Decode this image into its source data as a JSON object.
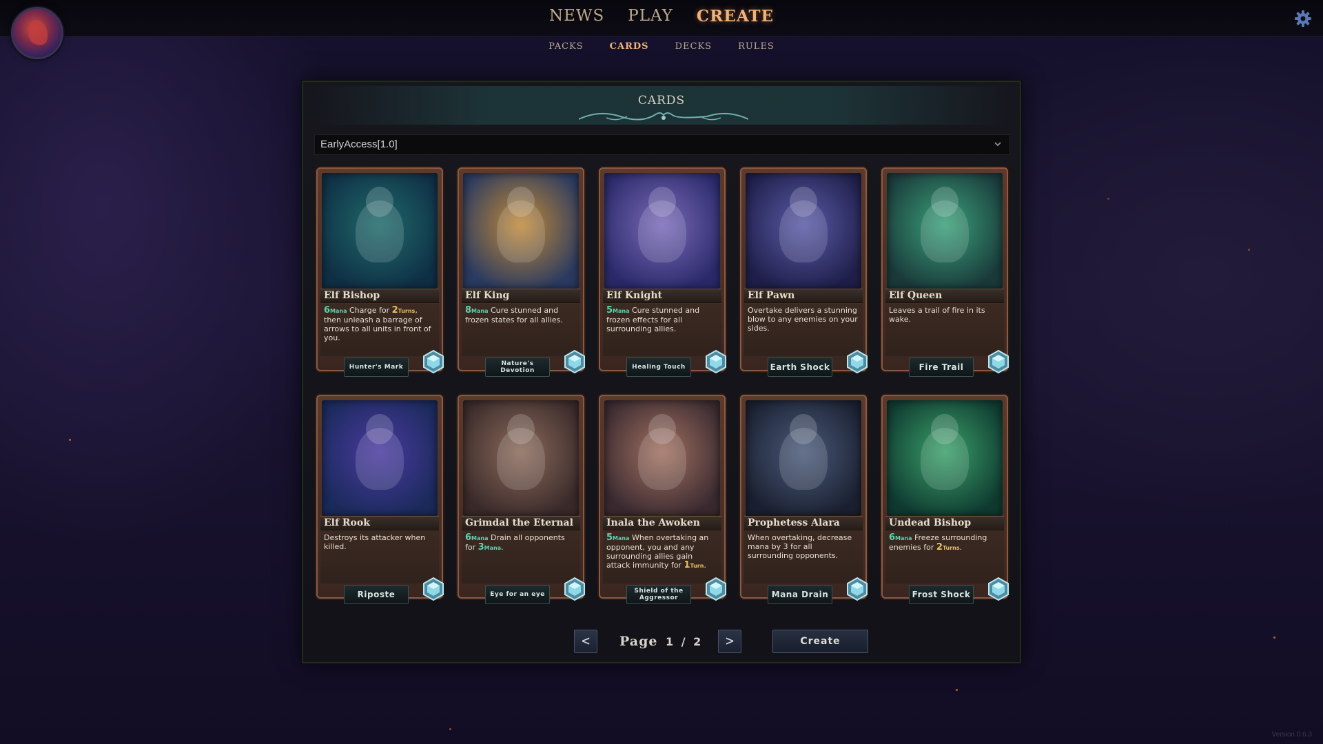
{
  "nav": {
    "main": [
      {
        "label": "NEWS",
        "active": false
      },
      {
        "label": "PLAY",
        "active": false
      },
      {
        "label": "CREATE",
        "active": true
      }
    ],
    "sub": [
      {
        "label": "PACKS",
        "active": false
      },
      {
        "label": "CARDS",
        "active": true
      },
      {
        "label": "DECKS",
        "active": false
      },
      {
        "label": "RULES",
        "active": false
      }
    ]
  },
  "icons": {
    "avatar": "dragon-avatar-icon",
    "settings": "gear-icon",
    "dropdown": "chevron-down-icon",
    "gem": "crystal-gem-icon"
  },
  "panel": {
    "title": "CARDS"
  },
  "set_selector": {
    "value": "EarlyAccess[1.0]"
  },
  "cards": [
    {
      "name": "Elf Bishop",
      "mana": "6",
      "mana_label": "Mana",
      "text_parts": [
        "Charge for ",
        "2",
        "Turns",
        ", then unleash a barrage of arrows to all units in front of you."
      ],
      "ability": "Hunter's Mark",
      "ability_size": "small",
      "art_colors": [
        "#1f6a6a",
        "#0f2f45"
      ]
    },
    {
      "name": "Elf King",
      "mana": "8",
      "mana_label": "Mana",
      "text": "Cure stunned and frozen states for all allies.",
      "ability": "Nature's Devotion",
      "ability_size": "small",
      "art_colors": [
        "#c08a3a",
        "#2a3a60"
      ]
    },
    {
      "name": "Elf Knight",
      "mana": "5",
      "mana_label": "Mana",
      "text": "Cure stunned and frozen effects for all surrounding allies.",
      "ability": "Healing Touch",
      "ability_size": "small",
      "art_colors": [
        "#7a6ab8",
        "#2a2a6a"
      ]
    },
    {
      "name": "Elf Pawn",
      "text": "Overtake delivers a stunning blow to any enemies on your sides.",
      "ability": "Earth Shock",
      "ability_size": "big",
      "art_colors": [
        "#5a5aa8",
        "#1f1f4a"
      ]
    },
    {
      "name": "Elf Queen",
      "text": "Leaves a trail of fire in its wake.",
      "ability": "Fire Trail",
      "ability_size": "big",
      "art_colors": [
        "#3aa07a",
        "#1a3a3a"
      ]
    },
    {
      "name": "Elf Rook",
      "text": "Destroys its attacker when killed.",
      "ability": "Riposte",
      "ability_size": "big",
      "art_colors": [
        "#4a3aa0",
        "#1a2a5a"
      ]
    },
    {
      "name": "Grimdal the Eternal",
      "mana": "6",
      "mana_label": "Mana",
      "text_parts": [
        "Drain all opponents for ",
        "3",
        "Mana",
        "."
      ],
      "ability": "Eye for an eye",
      "ability_size": "small",
      "art_colors": [
        "#8a6a5a",
        "#3a2a2a"
      ]
    },
    {
      "name": "Inala the Awoken",
      "mana": "5",
      "mana_label": "Mana",
      "text_parts": [
        "When overtaking an opponent, you and any surrounding allies gain attack immunity for ",
        "1",
        "Turn",
        "."
      ],
      "ability": "Shield of the Aggressor",
      "ability_size": "small",
      "art_colors": [
        "#a07060",
        "#3a2a30"
      ]
    },
    {
      "name": "Prophetess Alara",
      "text": "When overtaking, decrease mana by 3 for all surrounding opponents.",
      "ability": "Mana Drain",
      "ability_size": "big",
      "art_colors": [
        "#4a5a7a",
        "#1a2030"
      ]
    },
    {
      "name": "Undead Bishop",
      "mana": "6",
      "mana_label": "Mana",
      "text_parts": [
        "Freeze surrounding enemies for ",
        "2",
        "Turns",
        "."
      ],
      "ability": "Frost Shock",
      "ability_size": "big",
      "art_colors": [
        "#3aa06a",
        "#0f3a30"
      ]
    }
  ],
  "pagination": {
    "prev": "<",
    "next": ">",
    "label": "Page",
    "current": "1 / 2"
  },
  "actions": {
    "create": "Create"
  },
  "version": "Version 0.6.3"
}
